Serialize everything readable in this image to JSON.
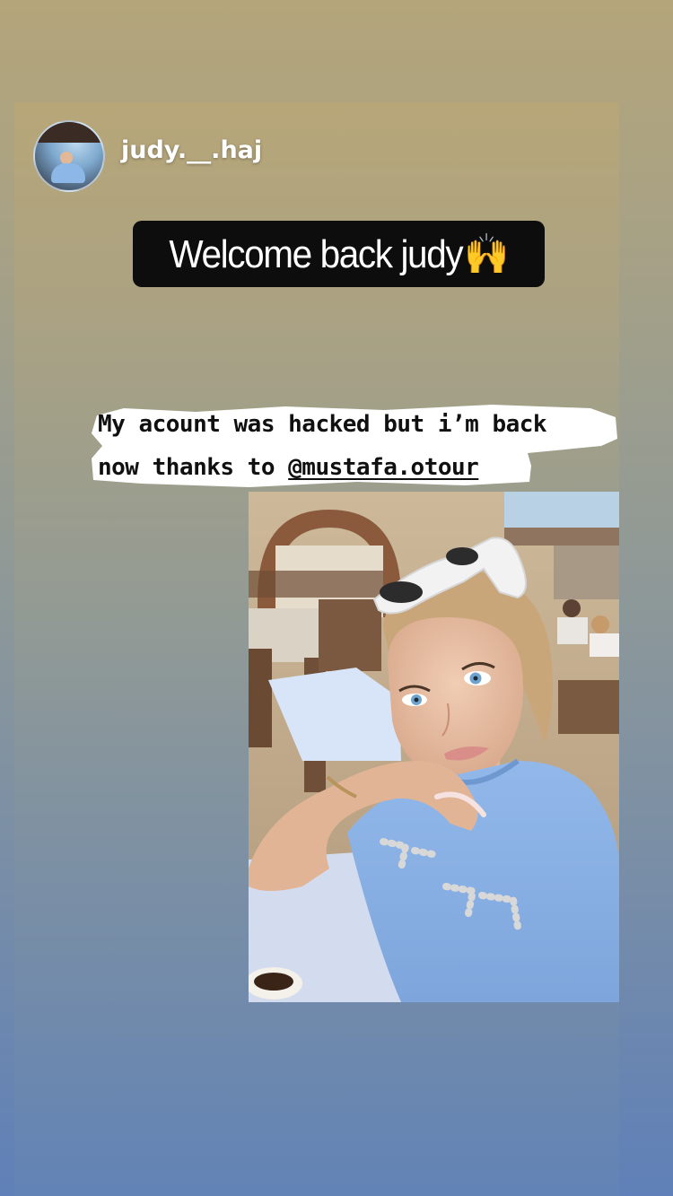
{
  "story": {
    "username": "judy.__.haj",
    "welcome_text": "Welcome back judy",
    "welcome_emoji": "🙌",
    "caption_line1": "My acount was hacked but i’m back",
    "caption_line2_prefix": "now thanks to ",
    "mention": "@mustafa.otour"
  },
  "colors": {
    "pill_background": "#0d0d0d",
    "caption_highlight": "#ffffff",
    "shirt": "#8fb4e6"
  },
  "icons": {
    "avatar": "profile-photo",
    "photo": "selfie-photo"
  }
}
